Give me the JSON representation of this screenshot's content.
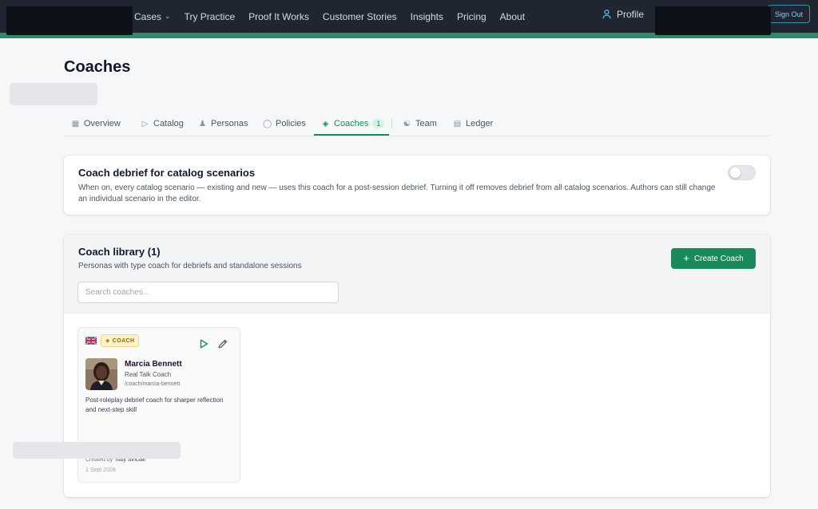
{
  "nav": {
    "links": [
      {
        "label": "Cases",
        "has_dropdown": true
      },
      {
        "label": "Try Practice"
      },
      {
        "label": "Proof It Works"
      },
      {
        "label": "Customer Stories"
      },
      {
        "label": "Insights"
      },
      {
        "label": "Pricing"
      },
      {
        "label": "About"
      }
    ],
    "profile_label": "Profile",
    "sign_out_label": "Sign Out",
    "colors": {
      "bar": "#1f2631",
      "accent_strip": "#2f8a6a"
    }
  },
  "page": {
    "title": "Coaches"
  },
  "tabs": [
    {
      "label": "Overview",
      "icon": "chart-icon"
    },
    {
      "label": "Catalog",
      "icon": "play-outline-icon"
    },
    {
      "label": "Personas",
      "icon": "user-icon"
    },
    {
      "label": "Policies",
      "icon": "shield-icon"
    },
    {
      "label": "Coaches",
      "icon": "graduation-cap-icon",
      "count": "1",
      "active": true
    },
    {
      "label": "Team",
      "icon": "team-icon"
    },
    {
      "label": "Ledger",
      "icon": "document-icon"
    }
  ],
  "debrief": {
    "title": "Coach debrief for catalog scenarios",
    "description": "When on, every catalog scenario — existing and new — uses this coach for a post-session debrief. Turning it off removes debrief from all catalog scenarios. Authors can still change an individual scenario in the editor.",
    "toggle_on": false
  },
  "library": {
    "title": "Coach library (1)",
    "subtitle": "Personas with type coach for debriefs and standalone sessions",
    "create_button_label": "Create Coach",
    "search_placeholder": "Search coaches...",
    "search_value": "",
    "coaches": [
      {
        "badge": "COACH",
        "flag": "uk-flag-icon",
        "name": "Marcia Bennett",
        "role": "Real Talk Coach",
        "slug": "/coach/marcia-bennett",
        "description": "Post-roleplay debrief coach for sharper reflection and next-step skill",
        "created_prefix": "Created by",
        "created_by": "Toby Sinclair",
        "date": "1 Sept 2026"
      }
    ]
  },
  "colors": {
    "brand_green": "#1a8a5c",
    "badge_bg": "#fdf2c8"
  }
}
